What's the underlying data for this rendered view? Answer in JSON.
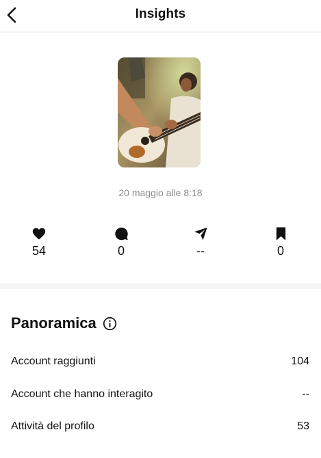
{
  "header": {
    "title": "Insights",
    "back_icon": "chevron-left-icon"
  },
  "post": {
    "thumbnail": "guitarist-photo",
    "date": "20 maggio alle 8:18"
  },
  "metrics": [
    {
      "icon": "heart-icon",
      "value": "54"
    },
    {
      "icon": "comment-icon",
      "value": "0"
    },
    {
      "icon": "send-icon",
      "value": "--"
    },
    {
      "icon": "bookmark-icon",
      "value": "0"
    }
  ],
  "overview": {
    "title": "Panoramica",
    "info_icon": "info-icon",
    "rows": [
      {
        "label": "Account raggiunti",
        "value": "104"
      },
      {
        "label": "Account che hanno interagito",
        "value": "--"
      },
      {
        "label": "Attività del profilo",
        "value": "53"
      }
    ]
  },
  "colors": {
    "text": "#111111",
    "muted": "#8e8e8e",
    "divider": "#f5f5f5"
  }
}
